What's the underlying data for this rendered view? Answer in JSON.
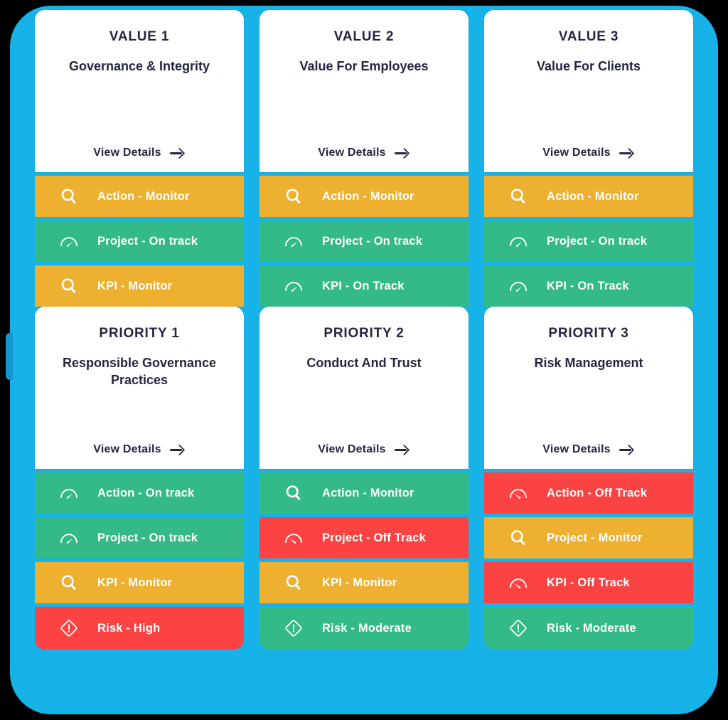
{
  "theme": {
    "background": "#000000",
    "device_blue": "#17B3E8",
    "card_white": "#FFFFFF",
    "text_dark": "#252541",
    "status_green": "#34BA86",
    "status_amber": "#EDB030",
    "status_red": "#FB4343"
  },
  "view_details_label": "View Details",
  "arrow_icon": "arrow-right-icon",
  "columns": [
    {
      "value_card": {
        "eyebrow": "VALUE 1",
        "title": "Governance & Integrity",
        "view_details": "View Details"
      },
      "value_statuses": [
        {
          "label": "Action - Monitor",
          "color": "#EDB030",
          "icon": "magnifier-icon"
        },
        {
          "label": "Project - On track",
          "color": "#34BA86",
          "icon": "gauge-on-track-icon"
        },
        {
          "label": "KPI - Monitor",
          "color": "#EDB030",
          "icon": "magnifier-icon"
        }
      ],
      "priority_card": {
        "eyebrow": "PRIORITY 1",
        "title": "Responsible Governance Practices",
        "view_details": "View Details"
      },
      "priority_statuses": [
        {
          "label": "Action - On track",
          "color": "#34BA86",
          "icon": "gauge-on-track-icon"
        },
        {
          "label": "Project - On track",
          "color": "#34BA86",
          "icon": "gauge-on-track-icon"
        },
        {
          "label": "KPI - Monitor",
          "color": "#EDB030",
          "icon": "magnifier-icon"
        },
        {
          "label": "Risk - High",
          "color": "#FB4343",
          "icon": "risk-diamond-icon"
        }
      ]
    },
    {
      "value_card": {
        "eyebrow": "VALUE 2",
        "title": "Value For Employees",
        "view_details": "View Details"
      },
      "value_statuses": [
        {
          "label": "Action - Monitor",
          "color": "#EDB030",
          "icon": "magnifier-icon"
        },
        {
          "label": "Project - On track",
          "color": "#34BA86",
          "icon": "gauge-on-track-icon"
        },
        {
          "label": "KPI - On Track",
          "color": "#34BA86",
          "icon": "gauge-on-track-icon"
        }
      ],
      "priority_card": {
        "eyebrow": "PRIORITY 2",
        "title": "Conduct And Trust",
        "view_details": "View Details"
      },
      "priority_statuses": [
        {
          "label": "Action - Monitor",
          "color": "#34BA86",
          "icon": "magnifier-icon"
        },
        {
          "label": "Project - Off Track",
          "color": "#FB4343",
          "icon": "gauge-off-track-icon"
        },
        {
          "label": "KPI - Monitor",
          "color": "#EDB030",
          "icon": "magnifier-icon"
        },
        {
          "label": "Risk - Moderate",
          "color": "#34BA86",
          "icon": "risk-diamond-icon"
        }
      ]
    },
    {
      "value_card": {
        "eyebrow": "VALUE 3",
        "title": "Value For Clients",
        "view_details": "View Details"
      },
      "value_statuses": [
        {
          "label": "Action - Monitor",
          "color": "#EDB030",
          "icon": "magnifier-icon"
        },
        {
          "label": "Project - On track",
          "color": "#34BA86",
          "icon": "gauge-on-track-icon"
        },
        {
          "label": "KPI - On Track",
          "color": "#34BA86",
          "icon": "gauge-on-track-icon"
        }
      ],
      "priority_card": {
        "eyebrow": "PRIORITY 3",
        "title": "Risk Management",
        "view_details": "View Details"
      },
      "priority_statuses": [
        {
          "label": "Action - Off Track",
          "color": "#FB4343",
          "icon": "gauge-off-track-icon"
        },
        {
          "label": "Project - Monitor",
          "color": "#EDB030",
          "icon": "magnifier-icon"
        },
        {
          "label": "KPI - Off Track",
          "color": "#FB4343",
          "icon": "gauge-off-track-icon"
        },
        {
          "label": "Risk - Moderate",
          "color": "#34BA86",
          "icon": "risk-diamond-icon"
        }
      ]
    }
  ]
}
